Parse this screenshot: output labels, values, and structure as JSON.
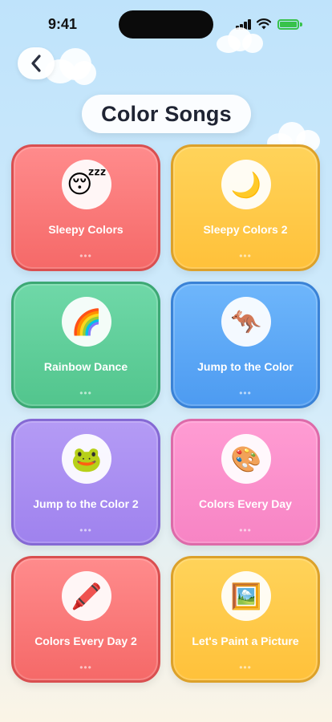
{
  "status_bar": {
    "time": "9:41",
    "battery_level": 1.0,
    "battery_color": "#37c24a"
  },
  "nav": {
    "back_icon": "chevron-left-icon"
  },
  "header": {
    "title": "Color Songs"
  },
  "songs": [
    {
      "label": "Sleepy Colors",
      "emoji": "😴",
      "icon": "sleeping-face-icon",
      "color": "#f56968",
      "dots": "•••"
    },
    {
      "label": "Sleepy Colors 2",
      "emoji": "🌙",
      "icon": "crescent-moon-icon",
      "color": "#ffc13a",
      "dots": "•••"
    },
    {
      "label": "Rainbow Dance",
      "emoji": "🌈",
      "icon": "rainbow-icon",
      "color": "#52c58d",
      "dots": "•••"
    },
    {
      "label": "Jump to the Color",
      "emoji": "🦘",
      "icon": "kangaroo-icon",
      "color": "#4d9bf1",
      "dots": "•••"
    },
    {
      "label": "Jump to the Color 2",
      "emoji": "🐸",
      "icon": "frog-icon",
      "color": "#9f82ee",
      "dots": "•••"
    },
    {
      "label": "Colors Every Day",
      "emoji": "🎨",
      "icon": "artist-palette-icon",
      "color": "#f784c4",
      "dots": "•••"
    },
    {
      "label": "Colors Every Day 2",
      "emoji": "🖍️",
      "icon": "crayon-icon",
      "color": "#f56968",
      "dots": "•••"
    },
    {
      "label": "Let's Paint a Picture",
      "emoji": "🖼️",
      "icon": "framed-picture-icon",
      "color": "#ffc13a",
      "dots": "•••"
    }
  ]
}
